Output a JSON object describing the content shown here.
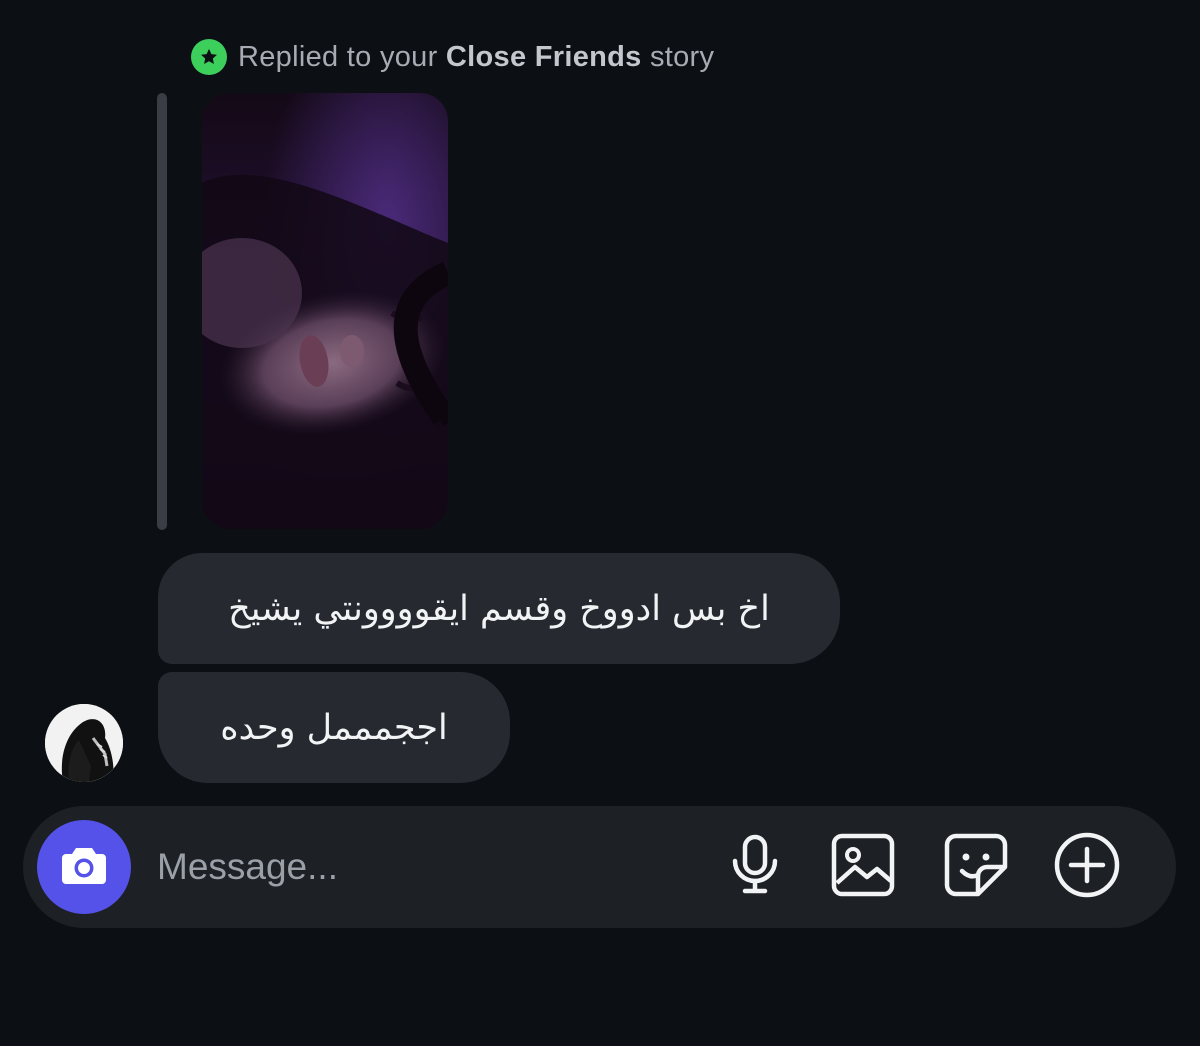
{
  "reply_header": {
    "prefix": "Replied to your ",
    "highlight": "Close Friends",
    "suffix": " story",
    "badge_color": "#3dcf5c",
    "badge_icon": "star-icon"
  },
  "story": {
    "thumbnail_description_icon": "story-photo"
  },
  "messages": [
    {
      "text": "اخ بس ادووخ وقسم ايقوووونتي يشيخ"
    },
    {
      "text": "اججمممل وحده"
    }
  ],
  "composer": {
    "placeholder": "Message...",
    "camera_icon": "camera-icon",
    "accent_color": "#5452e8",
    "tools": [
      "microphone-icon",
      "gallery-icon",
      "sticker-icon",
      "plus-icon"
    ]
  }
}
